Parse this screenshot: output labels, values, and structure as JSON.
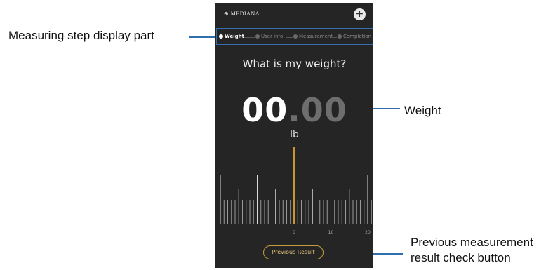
{
  "annotations": {
    "steps_label": "Measuring step display part",
    "weight_label": "Weight",
    "previous_label_line1": "Previous measurement",
    "previous_label_line2": "result check button"
  },
  "app": {
    "brand": "⊕ MEDIANA",
    "add_icon": "plus-icon"
  },
  "steps": [
    {
      "label": "Weight",
      "active": true
    },
    {
      "label": "User info",
      "active": false
    },
    {
      "label": "Measurement",
      "active": false
    },
    {
      "label": "Completion",
      "active": false
    }
  ],
  "question": "What is my weight?",
  "weight": {
    "integer": "00",
    "decimal": ".00",
    "unit": "lb"
  },
  "ruler": {
    "ticks": [
      "0",
      "10",
      "20"
    ],
    "pointer_value": 0,
    "accent": "#e0a030"
  },
  "previous_button": "Previous Result",
  "colors": {
    "callout": "#2f6fb0",
    "screen_bg": "#252525",
    "button_border": "#c89c3c"
  }
}
